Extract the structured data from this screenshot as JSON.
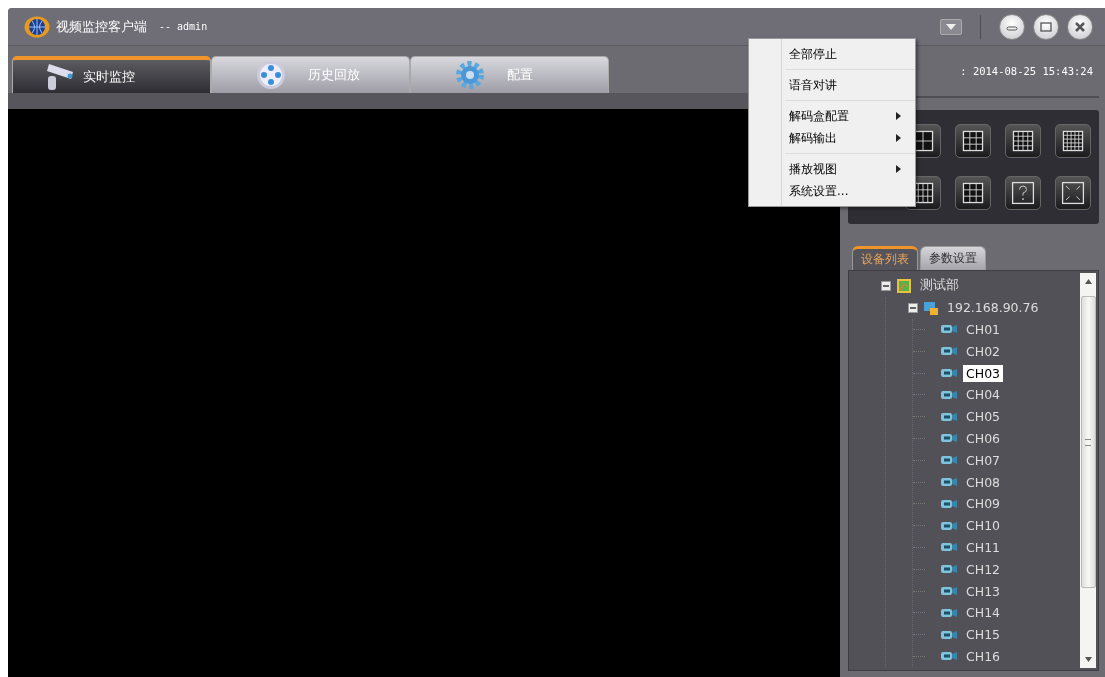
{
  "window": {
    "title": "视频监控客户端",
    "user": "-- admin"
  },
  "tabs": [
    {
      "label": "实时监控",
      "kind": "camera",
      "selected": true
    },
    {
      "label": "历史回放",
      "kind": "playback",
      "selected": false
    },
    {
      "label": "配置",
      "kind": "gear",
      "selected": false
    }
  ],
  "clock": ": 2014-08-25 15:43:24",
  "menu": [
    {
      "label": "全部停止",
      "submenu": false,
      "separator_after": true
    },
    {
      "label": "语音对讲",
      "submenu": false,
      "separator_after": true
    },
    {
      "label": "解码盒配置",
      "submenu": true,
      "separator_after": false
    },
    {
      "label": "解码输出",
      "submenu": true,
      "separator_after": true
    },
    {
      "label": "播放视图",
      "submenu": true,
      "separator_after": false
    },
    {
      "label": "系统设置...",
      "submenu": false,
      "separator_after": false
    }
  ],
  "panel_tabs": [
    {
      "label": "设备列表",
      "selected": true
    },
    {
      "label": "参数设置",
      "selected": false
    }
  ],
  "tree": [
    {
      "label": "测试部",
      "kind": "group",
      "expanded": true,
      "children": [
        {
          "label": "192.168.90.76",
          "kind": "device",
          "expanded": true,
          "children": [
            {
              "label": "CH01",
              "kind": "channel",
              "selected": false
            },
            {
              "label": "CH02",
              "kind": "channel",
              "selected": false
            },
            {
              "label": "CH03",
              "kind": "channel",
              "selected": true
            },
            {
              "label": "CH04",
              "kind": "channel",
              "selected": false
            },
            {
              "label": "CH05",
              "kind": "channel",
              "selected": false
            },
            {
              "label": "CH06",
              "kind": "channel",
              "selected": false
            },
            {
              "label": "CH07",
              "kind": "channel",
              "selected": false
            },
            {
              "label": "CH08",
              "kind": "channel",
              "selected": false
            },
            {
              "label": "CH09",
              "kind": "channel",
              "selected": false
            },
            {
              "label": "CH10",
              "kind": "channel",
              "selected": false
            },
            {
              "label": "CH11",
              "kind": "channel",
              "selected": false
            },
            {
              "label": "CH12",
              "kind": "channel",
              "selected": false
            },
            {
              "label": "CH13",
              "kind": "channel",
              "selected": false
            },
            {
              "label": "CH14",
              "kind": "channel",
              "selected": false
            },
            {
              "label": "CH15",
              "kind": "channel",
              "selected": false
            },
            {
              "label": "CH16",
              "kind": "channel",
              "selected": false
            }
          ]
        }
      ]
    }
  ]
}
